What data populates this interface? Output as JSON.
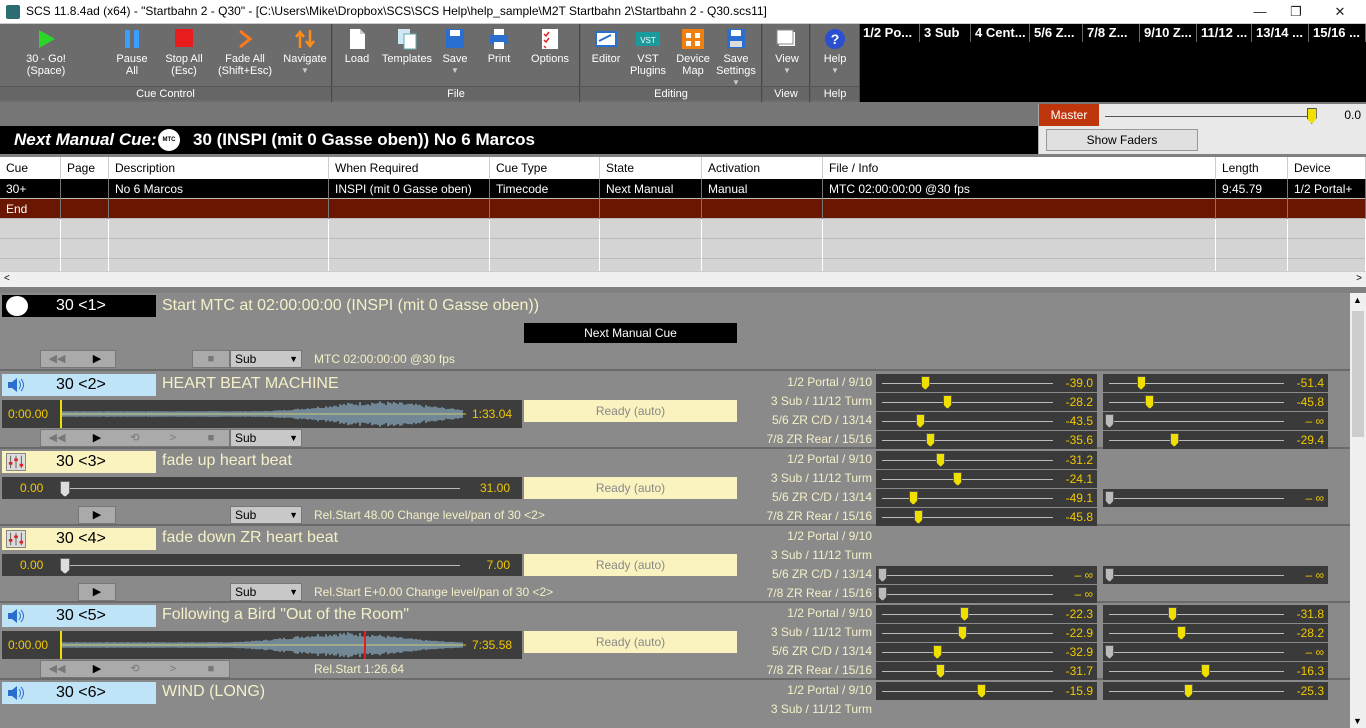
{
  "window": {
    "title": "SCS 11.8.4ad (x64) - \"Startbahn 2 - Q30\" - [C:\\Users\\Mike\\Dropbox\\SCS\\SCS Help\\help_sample\\M2T Startbahn 2\\Startbahn 2 - Q30.scs11]",
    "min": "—",
    "max": "❐",
    "close": "✕"
  },
  "ribbon": {
    "cue_control": {
      "label": "Cue Control",
      "go": "30 - Go!\n(Space)",
      "pause": "Pause\nAll",
      "stop": "Stop All\n(Esc)",
      "fade": "Fade All\n(Shift+Esc)",
      "navigate": "Navigate"
    },
    "file": {
      "label": "File",
      "load": "Load",
      "templates": "Templates",
      "save": "Save",
      "print": "Print",
      "options": "Options"
    },
    "editing": {
      "label": "Editing",
      "editor": "Editor",
      "vst": "VST\nPlugins",
      "device_map": "Device\nMap",
      "save_settings": "Save\nSettings"
    },
    "view": {
      "label": "View",
      "view": "View"
    },
    "help": {
      "label": "Help",
      "help": "Help"
    }
  },
  "sub_tabs": [
    "1/2 Po...",
    "3 Sub",
    "4 Cent...",
    "5/6 Z...",
    "7/8 Z...",
    "9/10 Z...",
    "11/12 ...",
    "13/14 ...",
    "15/16 ..."
  ],
  "next_cue": {
    "label": "Next Manual Cue:",
    "text": "30 (INSPI (mit 0 Gasse oben)) No 6 Marcos",
    "mtc": "MTC"
  },
  "master": {
    "label": "Master",
    "value": "0.0",
    "level": 0.97,
    "show_faders": "Show Faders"
  },
  "grid": {
    "headers": [
      "Cue",
      "Page",
      "Description",
      "When Required",
      "Cue Type",
      "State",
      "Activation",
      "File / Info",
      "Length",
      "Device"
    ],
    "rows": [
      [
        "30+",
        "",
        "No 6 Marcos",
        "INSPI (mit 0 Gasse oben)",
        "Timecode",
        "Next Manual",
        "Manual",
        "MTC 02:00:00:00 @30 fps",
        "9:45.79",
        "1/2 Portal+"
      ],
      [
        "End",
        "",
        "",
        "",
        "",
        "",
        "",
        "",
        "",
        ""
      ]
    ]
  },
  "sub1": {
    "id": "30 <1>",
    "desc": "Start MTC at 02:00:00:00  (INSPI (mit 0 Gasse oben))",
    "next": "Next Manual Cue",
    "sub": "Sub",
    "info": "MTC 02:00:00:00 @30 fps"
  },
  "sub2": {
    "id": "30 <2>",
    "desc": "HEART BEAT MACHINE",
    "start": "0:00.00",
    "end": "1:33.04",
    "ready": "Ready (auto)",
    "sub": "Sub",
    "devs": [
      {
        "name": "1/2 Portal / 9/10",
        "v1": "-39.0",
        "v2": "-51.4",
        "k1": 0.25,
        "k2": 0.18
      },
      {
        "name": "3 Sub / 11/12 Turm",
        "v1": "-28.2",
        "v2": "-45.8",
        "k1": 0.38,
        "k2": 0.23
      },
      {
        "name": "5/6 ZR C/D / 13/14",
        "v1": "-43.5",
        "v2": "– ∞",
        "k1": 0.22,
        "k2": 0.0
      },
      {
        "name": "7/8 ZR Rear / 15/16",
        "v1": "-35.6",
        "v2": "-29.4",
        "k1": 0.28,
        "k2": 0.37
      }
    ]
  },
  "sub3": {
    "id": "30 <3>",
    "desc": "fade up heart beat",
    "a": "0.00",
    "b": "31.00",
    "ready": "Ready (auto)",
    "sub": "Sub",
    "info": "Rel.Start 48.00    Change level/pan of 30 <2>",
    "devs": [
      {
        "name": "1/2 Portal / 9/10",
        "v1": "-31.2",
        "k1": 0.34
      },
      {
        "name": "3 Sub / 11/12 Turm",
        "v1": "-24.1",
        "k1": 0.44
      },
      {
        "name": "5/6 ZR C/D / 13/14",
        "v1": "-49.1",
        "v2": "– ∞",
        "k1": 0.18,
        "k2": 0.0
      },
      {
        "name": "7/8 ZR Rear / 15/16",
        "v1": "-45.8",
        "k1": 0.21
      }
    ]
  },
  "sub4": {
    "id": "30 <4>",
    "desc": "fade down ZR heart beat",
    "a": "0.00",
    "b": "7.00",
    "ready": "Ready (auto)",
    "sub": "Sub",
    "info": "Rel.Start E+0.00    Change level/pan of 30 <2>",
    "devs": [
      {
        "name": "1/2 Portal / 9/10"
      },
      {
        "name": "3 Sub / 11/12 Turm"
      },
      {
        "name": "5/6 ZR C/D / 13/14",
        "v1": "– ∞",
        "v2": "– ∞",
        "k1": 0.0,
        "k2": 0.0
      },
      {
        "name": "7/8 ZR Rear / 15/16",
        "v1": "– ∞",
        "k1": 0.0
      }
    ]
  },
  "sub5": {
    "id": "30 <5>",
    "desc": "Following a Bird \"Out of the Room\"",
    "start": "0:00.00",
    "end": "7:35.58",
    "ready": "Ready (auto)",
    "info": "Rel.Start 1:26.64",
    "devs": [
      {
        "name": "1/2 Portal / 9/10",
        "v1": "-22.3",
        "v2": "-31.8",
        "k1": 0.48,
        "k2": 0.36
      },
      {
        "name": "3 Sub / 11/12 Turm",
        "v1": "-22.9",
        "v2": "-28.2",
        "k1": 0.47,
        "k2": 0.41
      },
      {
        "name": "5/6 ZR C/D / 13/14",
        "v1": "-32.9",
        "v2": "– ∞",
        "k1": 0.32,
        "k2": 0.0
      },
      {
        "name": "7/8 ZR Rear / 15/16",
        "v1": "-31.7",
        "v2": "-16.3",
        "k1": 0.34,
        "k2": 0.55
      }
    ]
  },
  "sub6": {
    "id": "30 <6>",
    "desc": "WIND (LONG)",
    "devs": [
      {
        "name": "1/2 Portal / 9/10",
        "v1": "-15.9",
        "v2": "-25.3",
        "k1": 0.58,
        "k2": 0.45
      },
      {
        "name": "3 Sub / 11/12 Turm"
      }
    ]
  }
}
